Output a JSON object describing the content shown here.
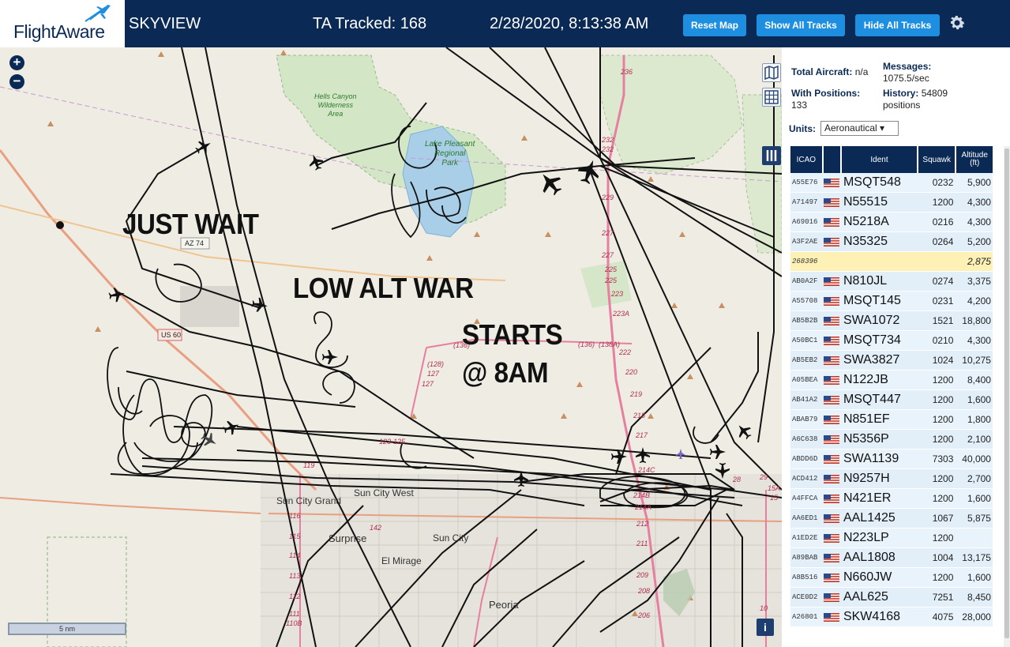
{
  "header": {
    "brand": "FlightAware",
    "app_name": "SKYVIEW",
    "tracked_label": "TA Tracked: 168",
    "datetime": "2/28/2020, 8:13:38 AM",
    "buttons": {
      "reset": "Reset Map",
      "show_all": "Show All Tracks",
      "hide_all": "Hide All Tracks"
    },
    "settings_icon": "gear-icon"
  },
  "map": {
    "zoom_in": "+",
    "zoom_out": "−",
    "annotations": [
      "JUST WAIT",
      "LOW ALT WAR",
      "STARTS",
      "@ 8AM"
    ],
    "places": {
      "hells_canyon": "Hells Canyon\nWilderness\nArea",
      "lake_pleasant": "Lake Pleasant\nRegional\nPark",
      "sun_city_grand": "Sun City Grand",
      "sun_city_west": "Sun City West",
      "surprise": "Surprise",
      "sun_city": "Sun City",
      "el_mirage": "El Mirage",
      "peoria": "Peoria"
    },
    "shields": {
      "az74": "AZ 74",
      "us60": "US 60"
    },
    "road_numbers": [
      "236",
      "232",
      "232",
      "229",
      "227",
      "227",
      "225",
      "225",
      "223",
      "223A",
      "222",
      "220",
      "219",
      "218",
      "217",
      "214C",
      "214B",
      "214A",
      "212",
      "211",
      "209",
      "208",
      "206",
      "(136)",
      "(136)",
      "(138A)",
      "(128)",
      "127",
      "127",
      "123",
      "125",
      "119",
      "116",
      "115",
      "114",
      "113",
      "112",
      "111",
      "110B",
      "142",
      "28",
      "29",
      "15A",
      "15",
      "10"
    ],
    "scale_label": "5 nm",
    "info": "i"
  },
  "panel": {
    "total_aircraft_label": "Total Aircraft:",
    "total_aircraft_value": "n/a",
    "messages_label": "Messages:",
    "messages_value": "1075.5/sec",
    "with_positions_label": "With Positions:",
    "with_positions_value": "133",
    "history_label": "History:",
    "history_value": "54809",
    "history_unit": "positions",
    "units_label": "Units:",
    "units_value": "Aeronautical ▾",
    "columns": {
      "icao": "ICAO",
      "ident": "Ident",
      "squawk": "Squawk",
      "altitude": "Altitude",
      "altitude_unit": "(ft)"
    },
    "rows": [
      {
        "icao": "A55E76",
        "ident": "MSQT548",
        "squawk": "0232",
        "altitude": "5,900",
        "flag": true
      },
      {
        "icao": "A71497",
        "ident": "N55515",
        "squawk": "1200",
        "altitude": "4,300",
        "flag": true
      },
      {
        "icao": "A69016",
        "ident": "N5218A",
        "squawk": "0216",
        "altitude": "4,300",
        "flag": true
      },
      {
        "icao": "A3F2AE",
        "ident": "N35325",
        "squawk": "0264",
        "altitude": "5,200",
        "flag": true
      },
      {
        "icao": "268396",
        "ident": "",
        "squawk": "",
        "altitude": "2,875",
        "flag": false,
        "selected": true
      },
      {
        "icao": "AB0A2F",
        "ident": "N810JL",
        "squawk": "0274",
        "altitude": "3,375",
        "flag": true
      },
      {
        "icao": "A55708",
        "ident": "MSQT145",
        "squawk": "0231",
        "altitude": "4,200",
        "flag": true
      },
      {
        "icao": "AB5B2B",
        "ident": "SWA1072",
        "squawk": "1521",
        "altitude": "18,800",
        "flag": true
      },
      {
        "icao": "A50BC1",
        "ident": "MSQT734",
        "squawk": "0210",
        "altitude": "4,300",
        "flag": true
      },
      {
        "icao": "AB5EB2",
        "ident": "SWA3827",
        "squawk": "1024",
        "altitude": "10,275",
        "flag": true
      },
      {
        "icao": "A05BEA",
        "ident": "N122JB",
        "squawk": "1200",
        "altitude": "8,400",
        "flag": true
      },
      {
        "icao": "AB41A2",
        "ident": "MSQT447",
        "squawk": "1200",
        "altitude": "1,600",
        "flag": true
      },
      {
        "icao": "ABAB79",
        "ident": "N851EF",
        "squawk": "1200",
        "altitude": "1,800",
        "flag": true
      },
      {
        "icao": "A6C638",
        "ident": "N5356P",
        "squawk": "1200",
        "altitude": "2,100",
        "flag": true
      },
      {
        "icao": "ABDD6D",
        "ident": "SWA1139",
        "squawk": "7303",
        "altitude": "40,000",
        "flag": true
      },
      {
        "icao": "ACD412",
        "ident": "N9257H",
        "squawk": "1200",
        "altitude": "2,700",
        "flag": true
      },
      {
        "icao": "A4FFCA",
        "ident": "N421ER",
        "squawk": "1200",
        "altitude": "1,600",
        "flag": true
      },
      {
        "icao": "AA6ED1",
        "ident": "AAL1425",
        "squawk": "1067",
        "altitude": "5,875",
        "flag": true
      },
      {
        "icao": "A1ED2E",
        "ident": "N223LP",
        "squawk": "1200",
        "altitude": "",
        "flag": true
      },
      {
        "icao": "A89BAB",
        "ident": "AAL1808",
        "squawk": "1004",
        "altitude": "13,175",
        "flag": true
      },
      {
        "icao": "A8B516",
        "ident": "N660JW",
        "squawk": "1200",
        "altitude": "1,600",
        "flag": true
      },
      {
        "icao": "ACE0D2",
        "ident": "AAL625",
        "squawk": "7251",
        "altitude": "8,450",
        "flag": true
      },
      {
        "icao": "A26801",
        "ident": "SKW4168",
        "squawk": "4075",
        "altitude": "28,000",
        "flag": true
      }
    ]
  },
  "colors": {
    "header_bg": "#0a2a55",
    "button_bg": "#1e8fe0",
    "row_selected": "#fdf1b6"
  }
}
